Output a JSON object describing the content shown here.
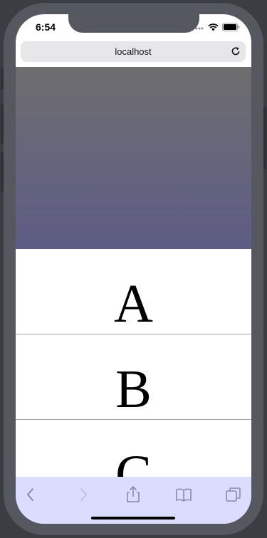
{
  "status_bar": {
    "time": "6:54"
  },
  "browser": {
    "address": "localhost"
  },
  "list": {
    "items": [
      "A",
      "B",
      "C"
    ]
  },
  "toolbar": {
    "buttons": [
      "back-icon",
      "forward-icon",
      "share-icon",
      "bookmarks-icon",
      "tabs-icon"
    ]
  },
  "colors": {
    "toolbar_bg": "#dcdcff",
    "hero_top": "#6d6d6d",
    "hero_bottom": "#5d5c84",
    "toolbar_icon": "#8a8aa8"
  }
}
